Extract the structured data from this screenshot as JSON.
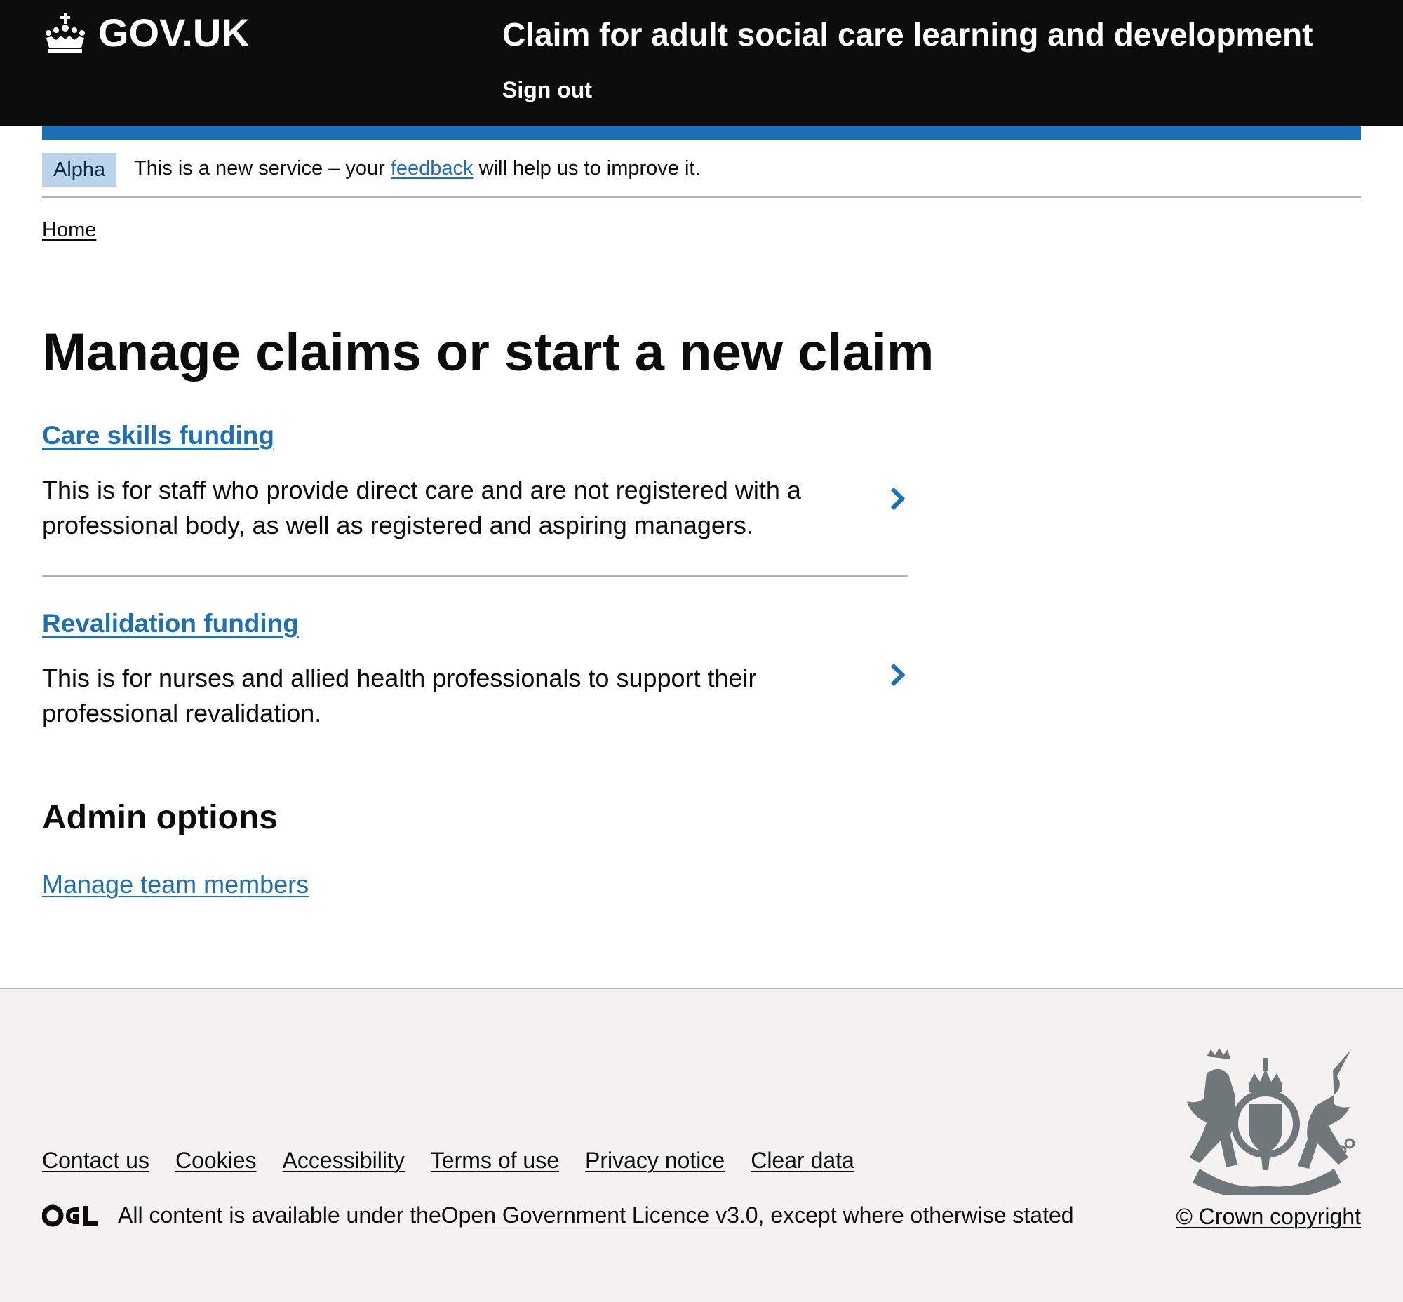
{
  "header": {
    "logo_text": "GOV.UK",
    "service_name": "Claim for adult social care learning and development",
    "sign_out": "Sign out"
  },
  "phase_banner": {
    "tag": "Alpha",
    "text_before": "This is a new service – your ",
    "link": "feedback",
    "text_after": " will help us to improve it."
  },
  "breadcrumb": {
    "home": "Home"
  },
  "main": {
    "title": "Manage claims or start a new claim",
    "cards": [
      {
        "title": "Care skills funding",
        "description": "This is for staff who provide direct care and are not registered with a professional body, as well as registered and aspiring managers."
      },
      {
        "title": "Revalidation funding",
        "description": "This is for nurses and allied health professionals to support their professional revalidation."
      }
    ],
    "admin_heading": "Admin options",
    "admin_link": "Manage team members"
  },
  "footer": {
    "links": [
      "Contact us",
      "Cookies",
      "Accessibility",
      "Terms of use",
      "Privacy notice",
      "Clear data"
    ],
    "licence_before": "All content is available under the ",
    "licence_link": "Open Government Licence v3.0",
    "licence_after": ", except where otherwise stated",
    "copyright": "© Crown copyright"
  },
  "colors": {
    "header_bg": "#0b0c0c",
    "link": "#1d70b8",
    "phase_tag_bg": "#bbd4ea",
    "footer_bg": "#f3f2f1"
  },
  "icons": [
    "crown-icon",
    "chevron-right-icon",
    "ogl-logo",
    "royal-coat-of-arms"
  ]
}
